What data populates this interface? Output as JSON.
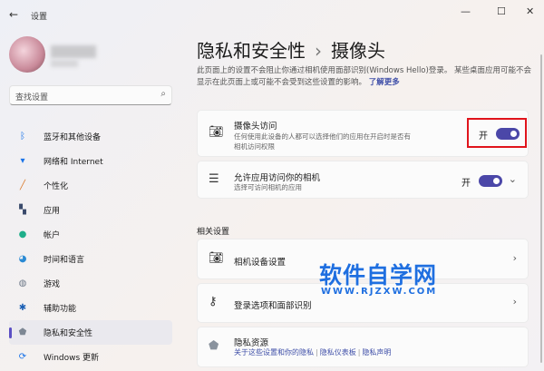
{
  "window": {
    "title": "设置",
    "back": "←",
    "minimize": "—",
    "maximize": "☐",
    "close": "✕"
  },
  "search": {
    "placeholder": "查找设置",
    "icon": "⌕"
  },
  "sidebar": {
    "items": [
      {
        "label": "蓝牙和其他设备",
        "icon": "bluetooth-icon",
        "glyph": "ᛒ",
        "color": "#1a73e8"
      },
      {
        "label": "网络和 Internet",
        "icon": "wifi-icon",
        "glyph": "▾",
        "color": "#1a73e8"
      },
      {
        "label": "个性化",
        "icon": "brush-icon",
        "glyph": "╱",
        "color": "#d9792b"
      },
      {
        "label": "应用",
        "icon": "apps-icon",
        "glyph": "▚",
        "color": "#3a4a6b"
      },
      {
        "label": "帐户",
        "icon": "account-icon",
        "glyph": "●",
        "color": "#1fae8a"
      },
      {
        "label": "时间和语言",
        "icon": "globe-clock-icon",
        "glyph": "◕",
        "color": "#2a8ad4"
      },
      {
        "label": "游戏",
        "icon": "gamepad-icon",
        "glyph": "◍",
        "color": "#6f7a8a"
      },
      {
        "label": "辅助功能",
        "icon": "accessibility-icon",
        "glyph": "✱",
        "color": "#1a5fb4"
      },
      {
        "label": "隐私和安全性",
        "icon": "shield-icon",
        "glyph": "⬟",
        "color": "#7d8794",
        "selected": true
      },
      {
        "label": "Windows 更新",
        "icon": "update-icon",
        "glyph": "⟳",
        "color": "#1a73e8"
      }
    ]
  },
  "main": {
    "breadcrumb_parent": "隐私和安全性",
    "breadcrumb_sep": "›",
    "title": "摄像头",
    "description": "此页面上的设置不会阻止你通过相机使用面部识别(Windows Hello)登录。 某些桌面应用可能不会显示在此页面上或可能不会受到这些设置的影响。",
    "learn_more": "了解更多",
    "camera_access": {
      "title": "摄像头访问",
      "subtitle": "任何使用此设备的人都可以选择他们的应用在开启时是否有相机访问权限",
      "state": "开",
      "on": true
    },
    "app_access": {
      "title": "允许应用访问你的相机",
      "subtitle": "选择可访问相机的应用",
      "state": "开",
      "on": true
    },
    "related_heading": "相关设置",
    "related": [
      {
        "title": "相机设备设置"
      },
      {
        "title": "登录选项和面部识别"
      }
    ],
    "privacy": {
      "title": "隐私资源",
      "links": [
        "关于这些设置和你的隐私",
        "隐私仪表板",
        "隐私声明"
      ]
    }
  },
  "watermark": {
    "title": "软件自学网",
    "url": "WWW.RJZXW.COM"
  },
  "colors": {
    "accent": "#4b47a8",
    "highlight": "#e0141c",
    "link": "#3f4fa8"
  }
}
